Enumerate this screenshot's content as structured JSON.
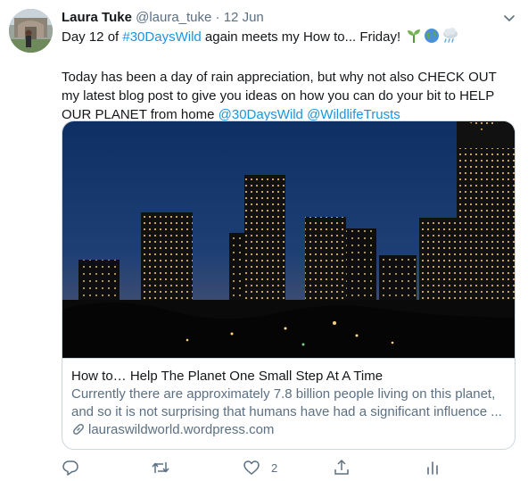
{
  "tweet": {
    "author_name": "Laura Tuke",
    "author_handle": "@laura_tuke",
    "separator": "·",
    "date": "12 Jun",
    "line1_pre": "Day 12 of ",
    "line1_hashtag": "#30DaysWild",
    "line1_post": " again meets my How to... Friday!",
    "paragraph2": "Today has been a day of rain appreciation, but why not also CHECK OUT my latest blog post to give you ideas on how you can do your bit to HELP OUR PLANET from home",
    "paragraph2_tag1": "@30DaysWild",
    "paragraph2_tag2": "@WildlifeTrusts",
    "emojis": [
      "seedling-icon",
      "globe-icon",
      "rain-cloud-icon"
    ]
  },
  "card": {
    "title": "How to… Help The Planet One Small Step At A Time",
    "desc_line1": "Currently there are approximately 7.8 billion people living on this planet,",
    "desc_line2": "and so it is not surprising that humans have had a significant influence ...",
    "domain": "lauraswildworld.wordpress.com"
  },
  "actions": {
    "reply_icon": "reply-icon",
    "retweet_icon": "retweet-icon",
    "like_icon": "heart-icon",
    "like_count": "2",
    "share_icon": "share-icon",
    "analytics_icon": "analytics-icon"
  },
  "colors": {
    "link": "#1b95e0",
    "muted": "#5b7083",
    "border": "#ccd6dd",
    "text": "#14171a"
  }
}
